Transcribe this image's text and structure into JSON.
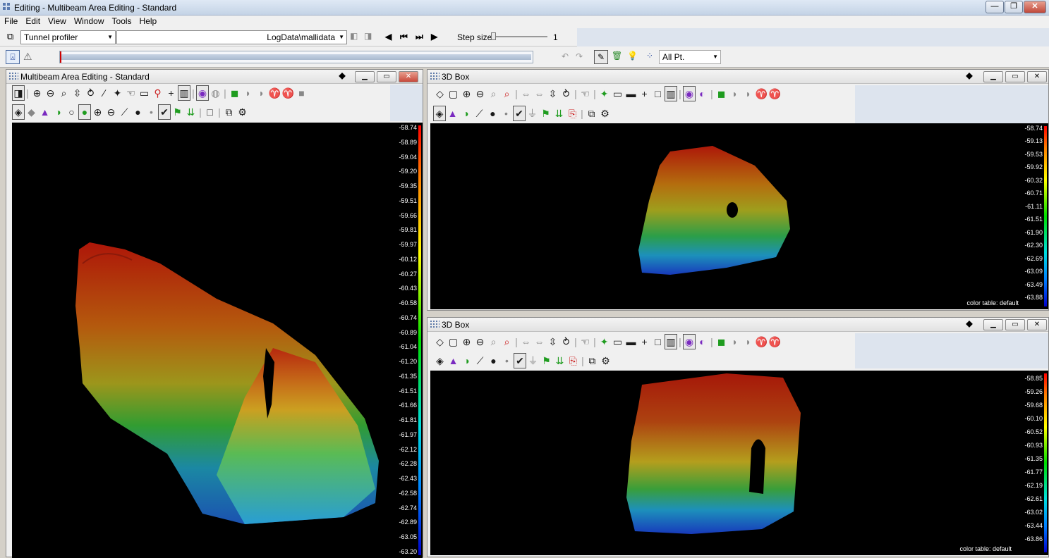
{
  "app": {
    "title": "Editing - Multibeam Area Editing - Standard",
    "caption_buttons": [
      "—",
      "❐",
      "✕"
    ]
  },
  "menu": [
    "File",
    "Edit",
    "View",
    "Window",
    "Tools",
    "Help"
  ],
  "toolbar": {
    "mode_combo": "Tunnel profiler",
    "data_path": "LogData\\mallidata",
    "step_label": "Step size",
    "step_value": "1",
    "progress_fraction": 0.0,
    "point_filter": "All Pt."
  },
  "main_window": {
    "title": "Multibeam Area Editing - Standard",
    "scale": [
      "-58.74",
      "-58.89",
      "-59.04",
      "-59.20",
      "-59.35",
      "-59.51",
      "-59.66",
      "-59.81",
      "-59.97",
      "-60.12",
      "-60.27",
      "-60.43",
      "-60.58",
      "-60.74",
      "-60.89",
      "-61.04",
      "-61.20",
      "-61.35",
      "-61.51",
      "-61.66",
      "-61.81",
      "-61.97",
      "-62.12",
      "-62.28",
      "-62.43",
      "-62.58",
      "-62.74",
      "-62.89",
      "-63.05",
      "-63.20"
    ]
  },
  "box_top": {
    "title": "3D Box",
    "scale": [
      "-58.74",
      "-59.13",
      "-59.53",
      "-59.92",
      "-60.32",
      "-60.71",
      "-61.11",
      "-61.51",
      "-61.90",
      "-62.30",
      "-62.69",
      "-63.09",
      "-63.49",
      "-63.88"
    ],
    "color_table": "color table: default"
  },
  "box_bottom": {
    "title": "3D Box",
    "scale": [
      "-58.85",
      "-59.26",
      "-59.68",
      "-60.10",
      "-60.52",
      "-60.93",
      "-61.35",
      "-61.77",
      "-62.19",
      "-62.61",
      "-63.02",
      "-63.44",
      "-63.86"
    ],
    "color_table": "color table: default"
  },
  "colors": {
    "window_bg": "#f0f0f0",
    "view_bg": "#000000",
    "close_red": "#d9534f"
  }
}
